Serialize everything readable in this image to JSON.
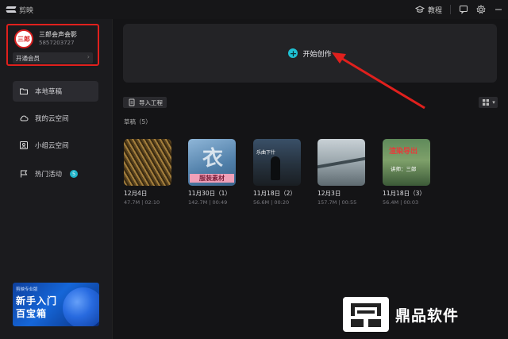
{
  "titlebar": {
    "app_name": "剪映",
    "tutorial_label": "教程"
  },
  "profile": {
    "avatar_text": "三郎",
    "name": "三郎会声会影",
    "id": "5857203727",
    "vip_label": "开通会员"
  },
  "sidebar": {
    "items": [
      {
        "label": "本地草稿"
      },
      {
        "label": "我的云空间"
      },
      {
        "label": "小组云空间"
      },
      {
        "label": "热门活动",
        "badge": "5"
      }
    ]
  },
  "promo": {
    "top_text": "剪映专业版",
    "line1": "新手入门",
    "line2": "百宝箱"
  },
  "main": {
    "create_label": "开始创作",
    "import_label": "导入工程",
    "section_label": "草稿（5）"
  },
  "drafts": [
    {
      "date": "12月4日",
      "meta": "47.7M | 02:10"
    },
    {
      "date": "11月30日（1）",
      "meta": "142.7M | 00:49",
      "overlay": "服装素材",
      "glyph": "衣"
    },
    {
      "date": "11月18日（2）",
      "meta": "56.6M | 00:20",
      "overlay": "乐曲下什"
    },
    {
      "date": "12月3日",
      "meta": "157.7M | 00:55"
    },
    {
      "date": "11月18日（3）",
      "meta": "56.4M | 00:03",
      "overlay": "渲染导出",
      "overlay2": "讲师：三郎"
    }
  ],
  "watermark": {
    "text": "鼎品软件"
  },
  "colors": {
    "accent": "#1fc0d2",
    "highlight_box": "#e0201d",
    "arrow": "#e0201d"
  }
}
